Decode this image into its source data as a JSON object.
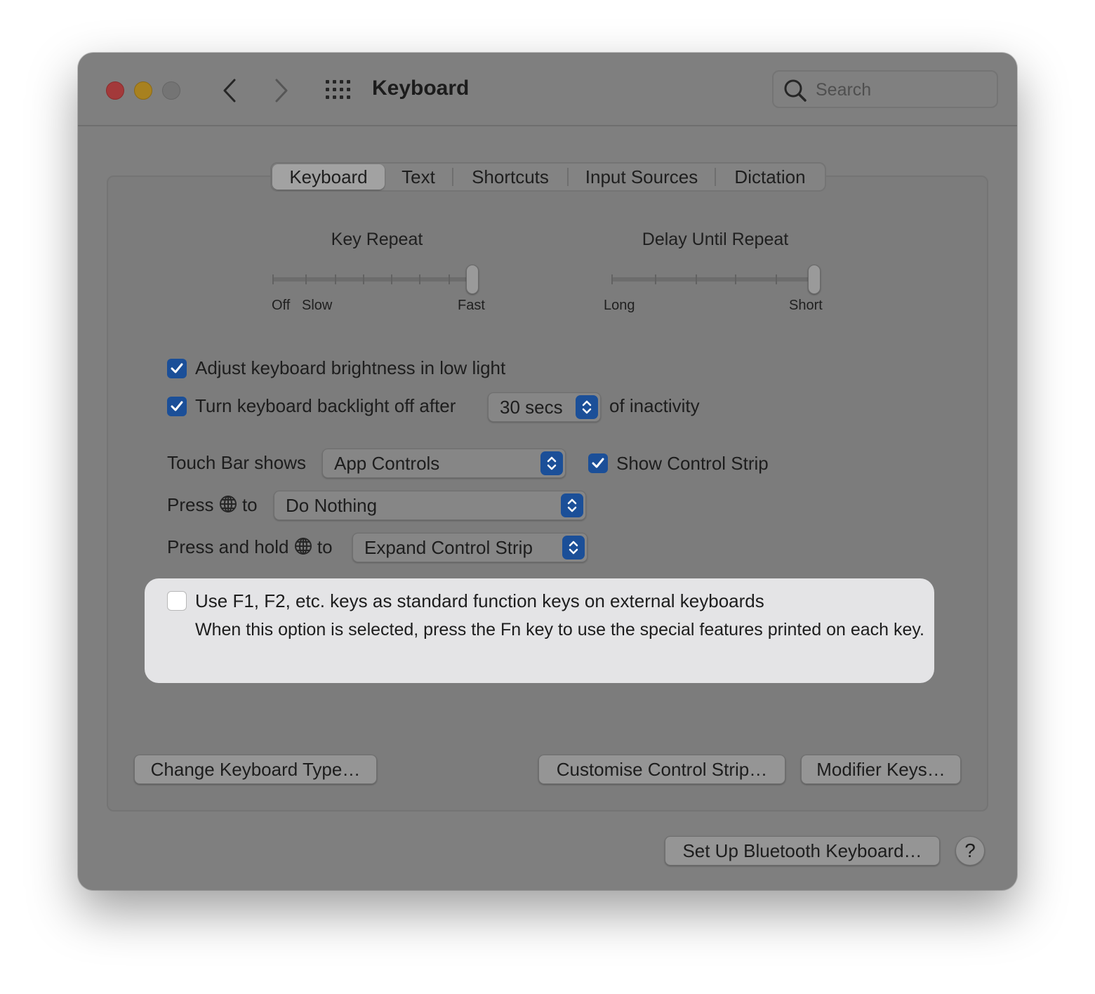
{
  "window": {
    "title": "Keyboard",
    "search_placeholder": "Search"
  },
  "tabs": [
    {
      "label": "Keyboard",
      "active": true
    },
    {
      "label": "Text",
      "active": false
    },
    {
      "label": "Shortcuts",
      "active": false
    },
    {
      "label": "Input Sources",
      "active": false
    },
    {
      "label": "Dictation",
      "active": false
    }
  ],
  "key_repeat": {
    "title": "Key Repeat",
    "labels": [
      "Off",
      "Slow",
      "Fast"
    ],
    "value_fraction": 1.0
  },
  "delay_until_repeat": {
    "title": "Delay Until Repeat",
    "labels": [
      "Long",
      "Short"
    ],
    "value_fraction": 1.0
  },
  "options": {
    "brightness_label": "Adjust keyboard brightness in low light",
    "brightness_checked": true,
    "backlight_label": "Turn keyboard backlight off after",
    "backlight_checked": true,
    "backlight_value": "30 secs",
    "backlight_suffix": "of inactivity"
  },
  "touch_bar": {
    "label": "Touch Bar shows",
    "value": "App Controls",
    "control_strip_label": "Show Control Strip",
    "control_strip_checked": true
  },
  "press_globe": {
    "label_prefix": "Press",
    "label_suffix": "to",
    "value": "Do Nothing"
  },
  "press_hold_globe": {
    "label_prefix": "Press and hold",
    "label_suffix": "to",
    "value": "Expand Control Strip"
  },
  "fn_keys": {
    "label": "Use F1, F2, etc. keys as standard function keys on external keyboards",
    "checked": false,
    "description": "When this option is selected, press the Fn key to use the special features printed on each key."
  },
  "buttons": {
    "change_type": "Change Keyboard Type…",
    "customise_strip": "Customise Control Strip…",
    "modifier_keys": "Modifier Keys…",
    "bluetooth": "Set Up Bluetooth Keyboard…",
    "help": "?"
  },
  "colors": {
    "accent": "#1b4f98",
    "window_bg": "#7f7f7f",
    "highlight_bg": "#e4e4e6"
  }
}
